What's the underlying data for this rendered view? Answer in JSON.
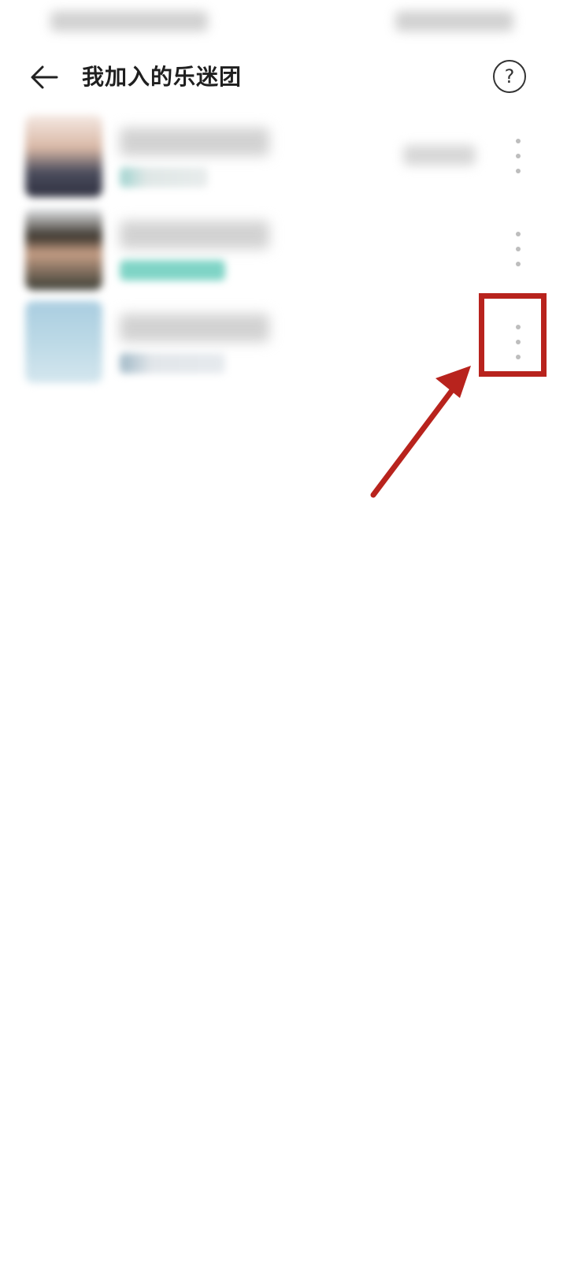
{
  "header": {
    "title": "我加入的乐迷团",
    "help_glyph": "?"
  },
  "list": {
    "items": [
      {
        "avatar": "avatar-image",
        "more": "more-options-icon"
      },
      {
        "avatar": "avatar-image",
        "more": "more-options-icon"
      },
      {
        "avatar": "avatar-image",
        "more": "more-options-icon"
      }
    ]
  },
  "colors": {
    "title": "#1f1f1f",
    "annotation": "#b8231d",
    "teal_tag": "#7fd4c6",
    "dot": "#bdbdbd"
  },
  "icons": {
    "back": "arrow-left-icon",
    "help": "question-circle-icon",
    "more": "vertical-dots-icon"
  }
}
